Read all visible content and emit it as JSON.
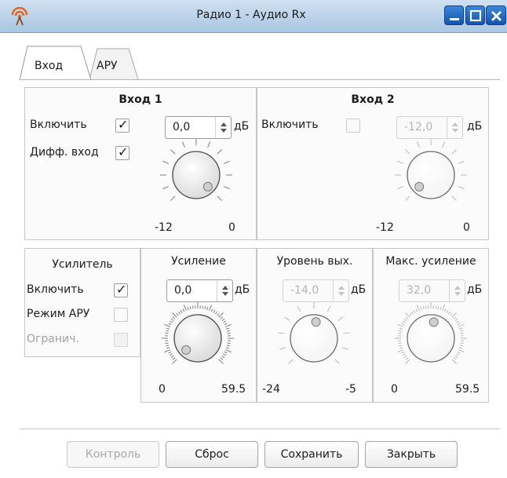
{
  "window": {
    "title": "Радио 1 - Аудио Rx",
    "icon": "radio-signal-icon",
    "controls": [
      "minimize-icon",
      "maximize-icon",
      "close-icon"
    ],
    "titlebar_color": "#aac6e3",
    "button_color": "#1454ac"
  },
  "tabs": [
    {
      "label": "Вход",
      "active": true
    },
    {
      "label": "АРУ",
      "active": false
    }
  ],
  "input1": {
    "title": "Вход 1",
    "enable_label": "Включить",
    "enable_checked": true,
    "diff_label": "Дифф. вход",
    "diff_checked": true,
    "value": "0,0",
    "unit": "дБ",
    "min_label": "-12",
    "max_label": "0",
    "level": 1.0
  },
  "input2": {
    "title": "Вход 2",
    "enable_label": "Включить",
    "enable_checked": false,
    "value": "-12,0",
    "unit": "дБ",
    "min_label": "-12",
    "max_label": "0",
    "level": 0.0
  },
  "amplifier": {
    "title": "Усилитель",
    "enable_label": "Включить",
    "enable_checked": true,
    "agc_label": "Режим АРУ",
    "agc_checked": false,
    "limit_label": "Огранич.",
    "limit_checked": false
  },
  "gain": {
    "title": "Усиление",
    "value": "0,0",
    "unit": "дБ",
    "min_label": "0",
    "max_label": "59.5",
    "level": 0.0
  },
  "out_level": {
    "title": "Уровень вых.",
    "value": "-14,0",
    "unit": "дБ",
    "min_label": "-24",
    "max_label": "-5",
    "level": 0.526
  },
  "max_gain": {
    "title": "Макс. усиление",
    "value": "32,0",
    "unit": "дБ",
    "min_label": "0",
    "max_label": "59.5",
    "level": 0.538
  },
  "buttons": {
    "monitor": "Контроль",
    "reset": "Сброс",
    "save": "Сохранить",
    "close": "Закрыть"
  }
}
